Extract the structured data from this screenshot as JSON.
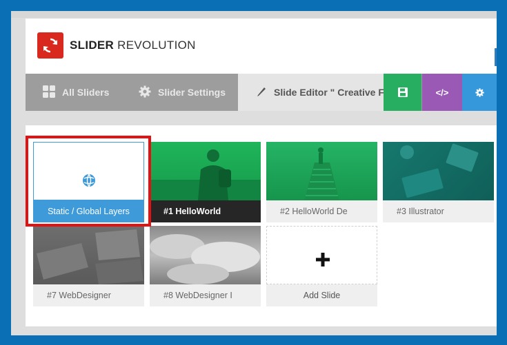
{
  "app": {
    "brand_bold": "SLIDER",
    "brand_light": "REVOLUTION",
    "logo_icon": "refresh-icon",
    "logo_color": "#d9281d"
  },
  "toolbar": {
    "tabs": [
      {
        "label": "All Sliders",
        "icon": "grid-icon"
      },
      {
        "label": "Slider Settings",
        "icon": "gear-icon"
      },
      {
        "label": "Slide Editor \" Creative F",
        "icon": "pencil-icon"
      }
    ],
    "buttons": [
      {
        "icon": "save-icon",
        "color": "#27ae60"
      },
      {
        "label": "</>",
        "icon": "code-icon",
        "color": "#9b59b6"
      },
      {
        "icon": "gear-icon",
        "color": "#3498db"
      }
    ]
  },
  "slides": [
    {
      "label": "Static / Global Layers",
      "icon": "globe-icon",
      "style": "static"
    },
    {
      "label": "#1 HelloWorld",
      "style": "active"
    },
    {
      "label": "#2 HelloWorld De",
      "style": "normal"
    },
    {
      "label": "#3 Illustrator",
      "style": "normal"
    },
    {
      "label": "#7 WebDesigner",
      "style": "normal"
    },
    {
      "label": "#8 WebDesigner I",
      "style": "normal"
    },
    {
      "label": "Add Slide",
      "icon": "plus-icon",
      "style": "add"
    }
  ],
  "colors": {
    "background": "#0b6fb5",
    "highlight": "#e31212",
    "static_caption": "#3f9ad9",
    "green_overlay": "#1aaa55",
    "teal_overlay": "#137a72"
  }
}
